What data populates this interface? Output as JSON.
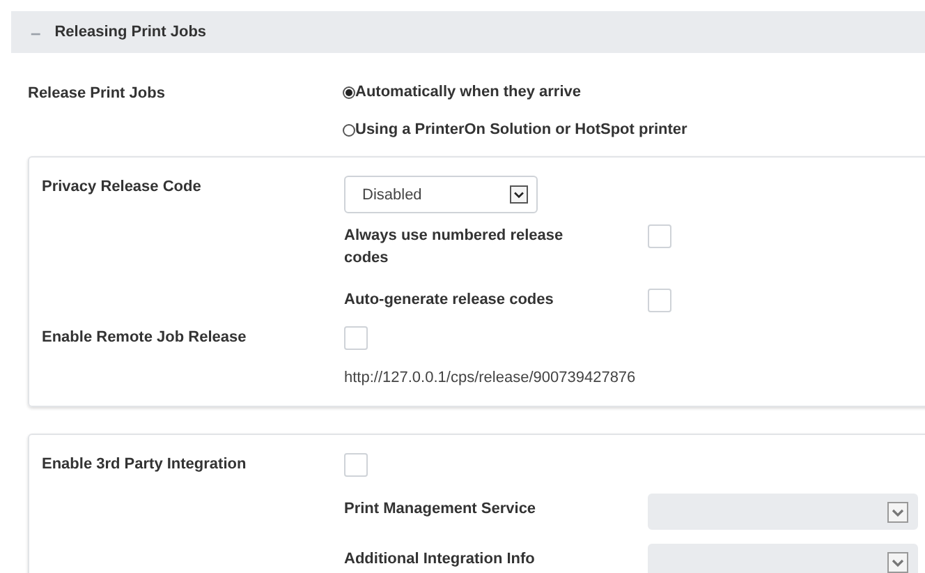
{
  "section": {
    "title": "Releasing Print Jobs",
    "expanded": true,
    "toggle": "–"
  },
  "release_print_jobs": {
    "label": "Release Print Jobs",
    "options": [
      {
        "label": "Automatically when they arrive",
        "selected": true
      },
      {
        "label": "Using a PrinterOn Solution or HotSpot printer",
        "selected": false
      }
    ]
  },
  "privacy_panel": {
    "label": "Privacy Release Code",
    "select": {
      "value": "Disabled"
    },
    "options": [
      {
        "label": "Always use numbered release codes",
        "checked": false
      },
      {
        "label": "Auto-generate release codes",
        "checked": false
      }
    ],
    "remote_release": {
      "label": "Enable Remote Job Release",
      "checked": false,
      "url": "http://127.0.0.1/cps/release/900739427876"
    }
  },
  "integration_panel": {
    "label": "Enable 3rd Party Integration",
    "checked": false,
    "fields": [
      {
        "label": "Print Management Service",
        "disabled": true
      },
      {
        "label": "Additional Integration Info",
        "disabled": true
      }
    ]
  }
}
